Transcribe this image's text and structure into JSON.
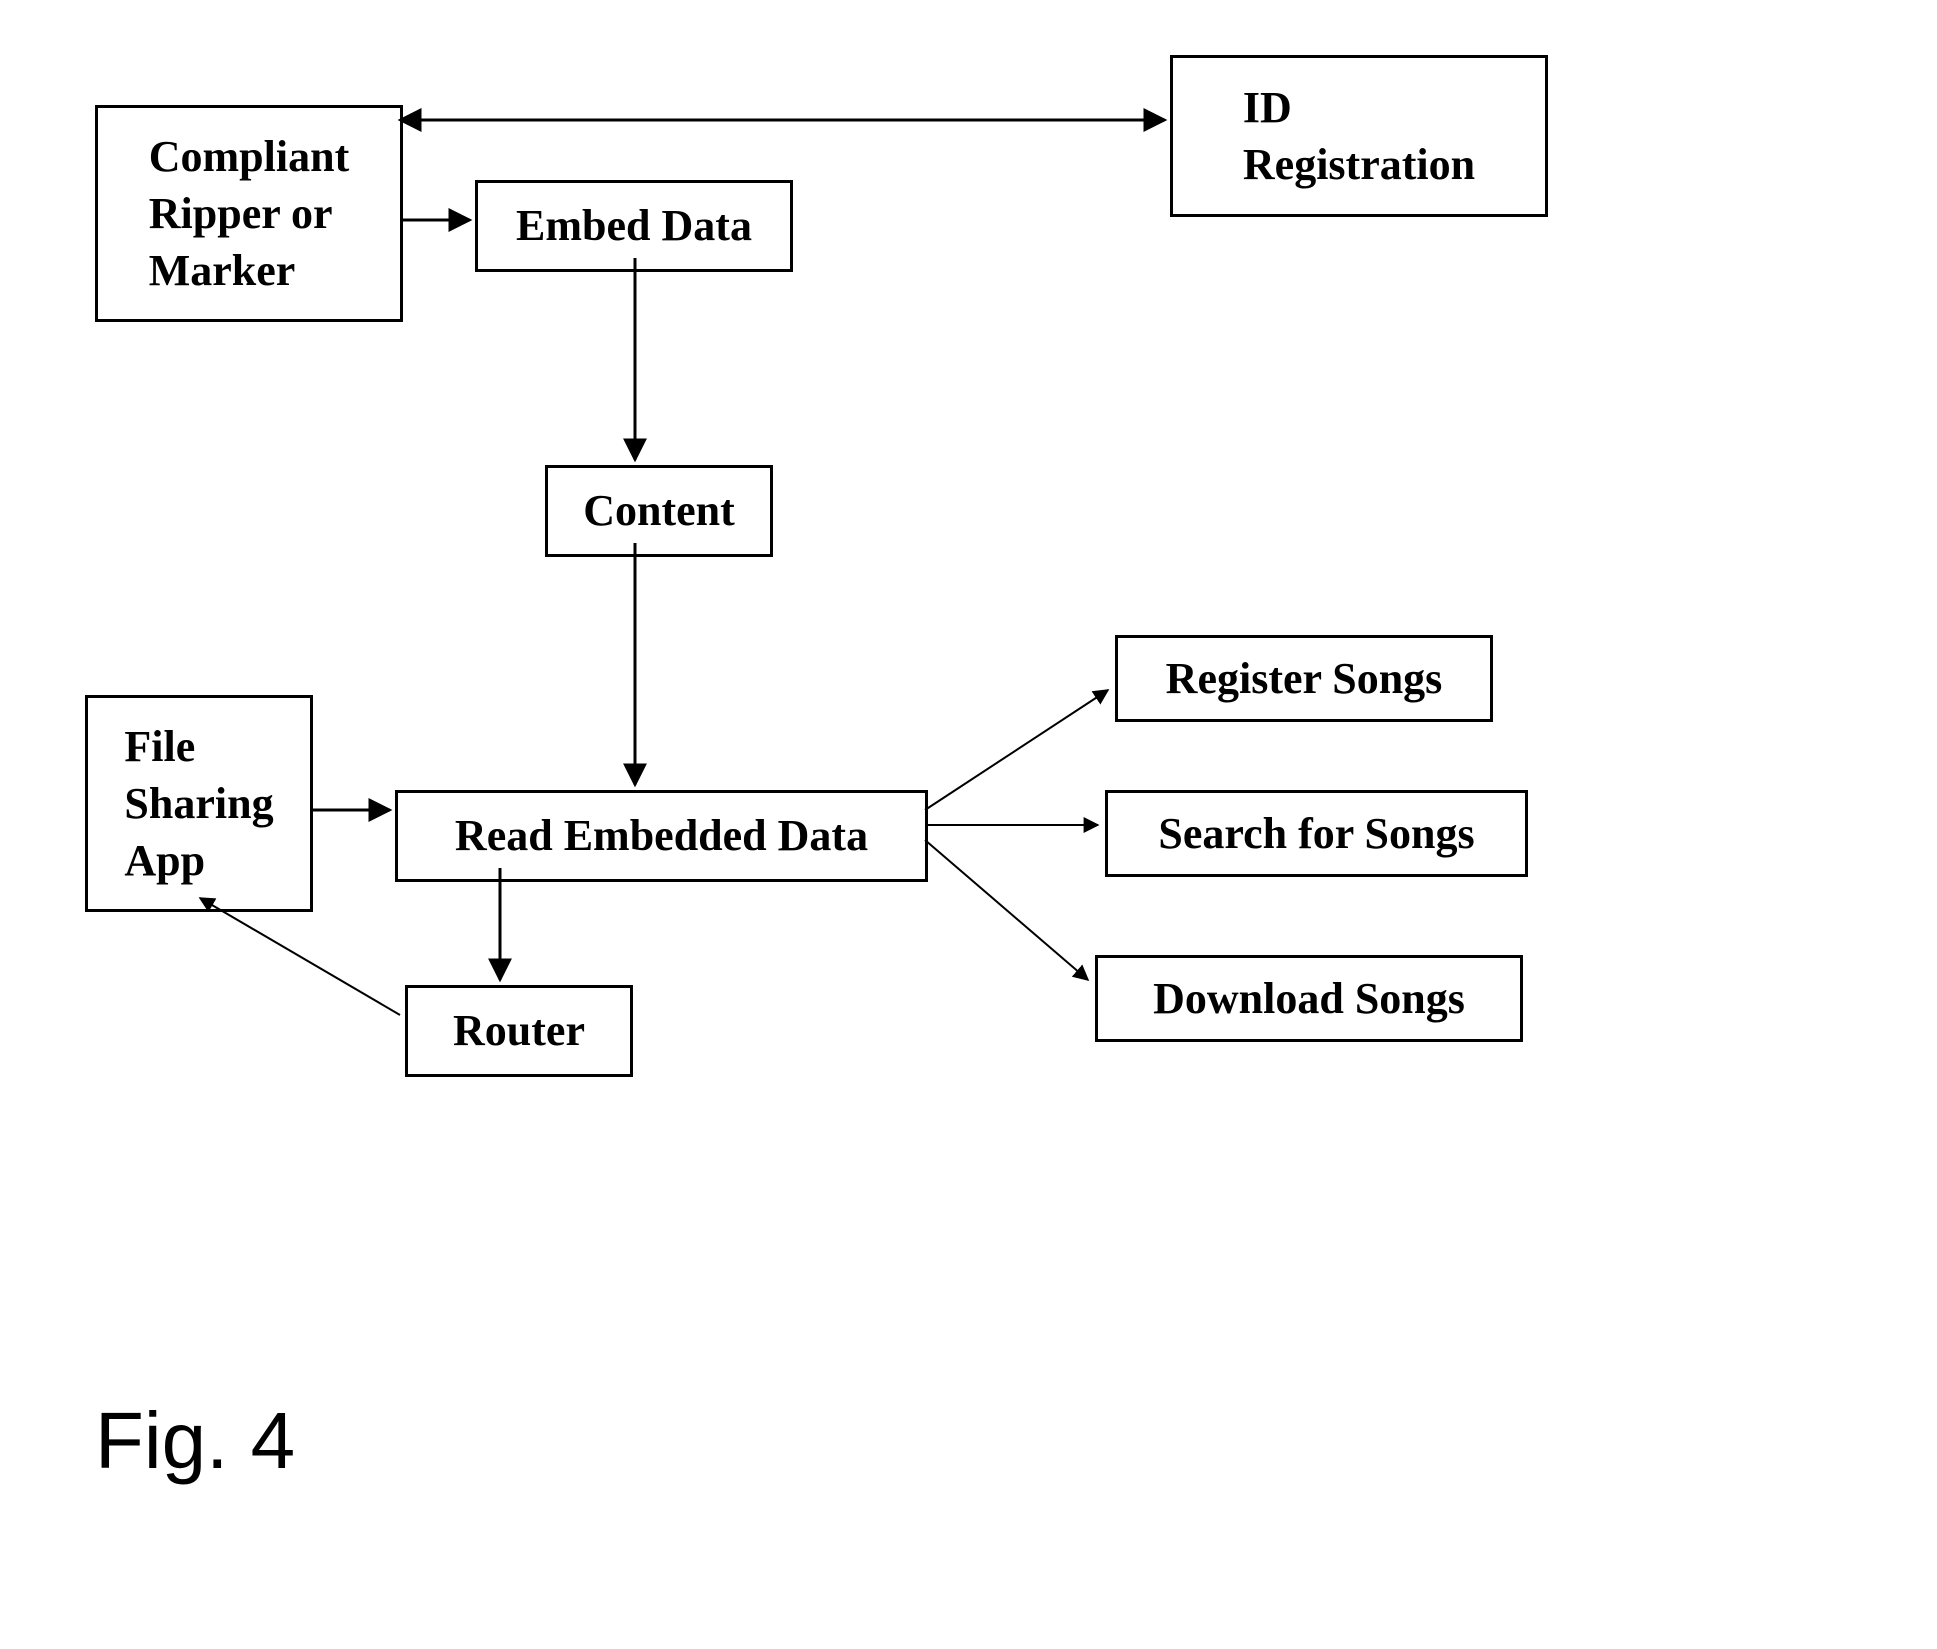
{
  "nodes": {
    "compliant": "Compliant\nRipper or\nMarker",
    "idReg": "ID\nRegistration",
    "embed": "Embed Data",
    "content": "Content",
    "fileSharing": "File\nSharing\nApp",
    "read": "Read Embedded Data",
    "registerSongs": "Register Songs",
    "searchSongs": "Search for Songs",
    "downloadSongs": "Download Songs",
    "router": "Router"
  },
  "figLabel": "Fig. 4"
}
